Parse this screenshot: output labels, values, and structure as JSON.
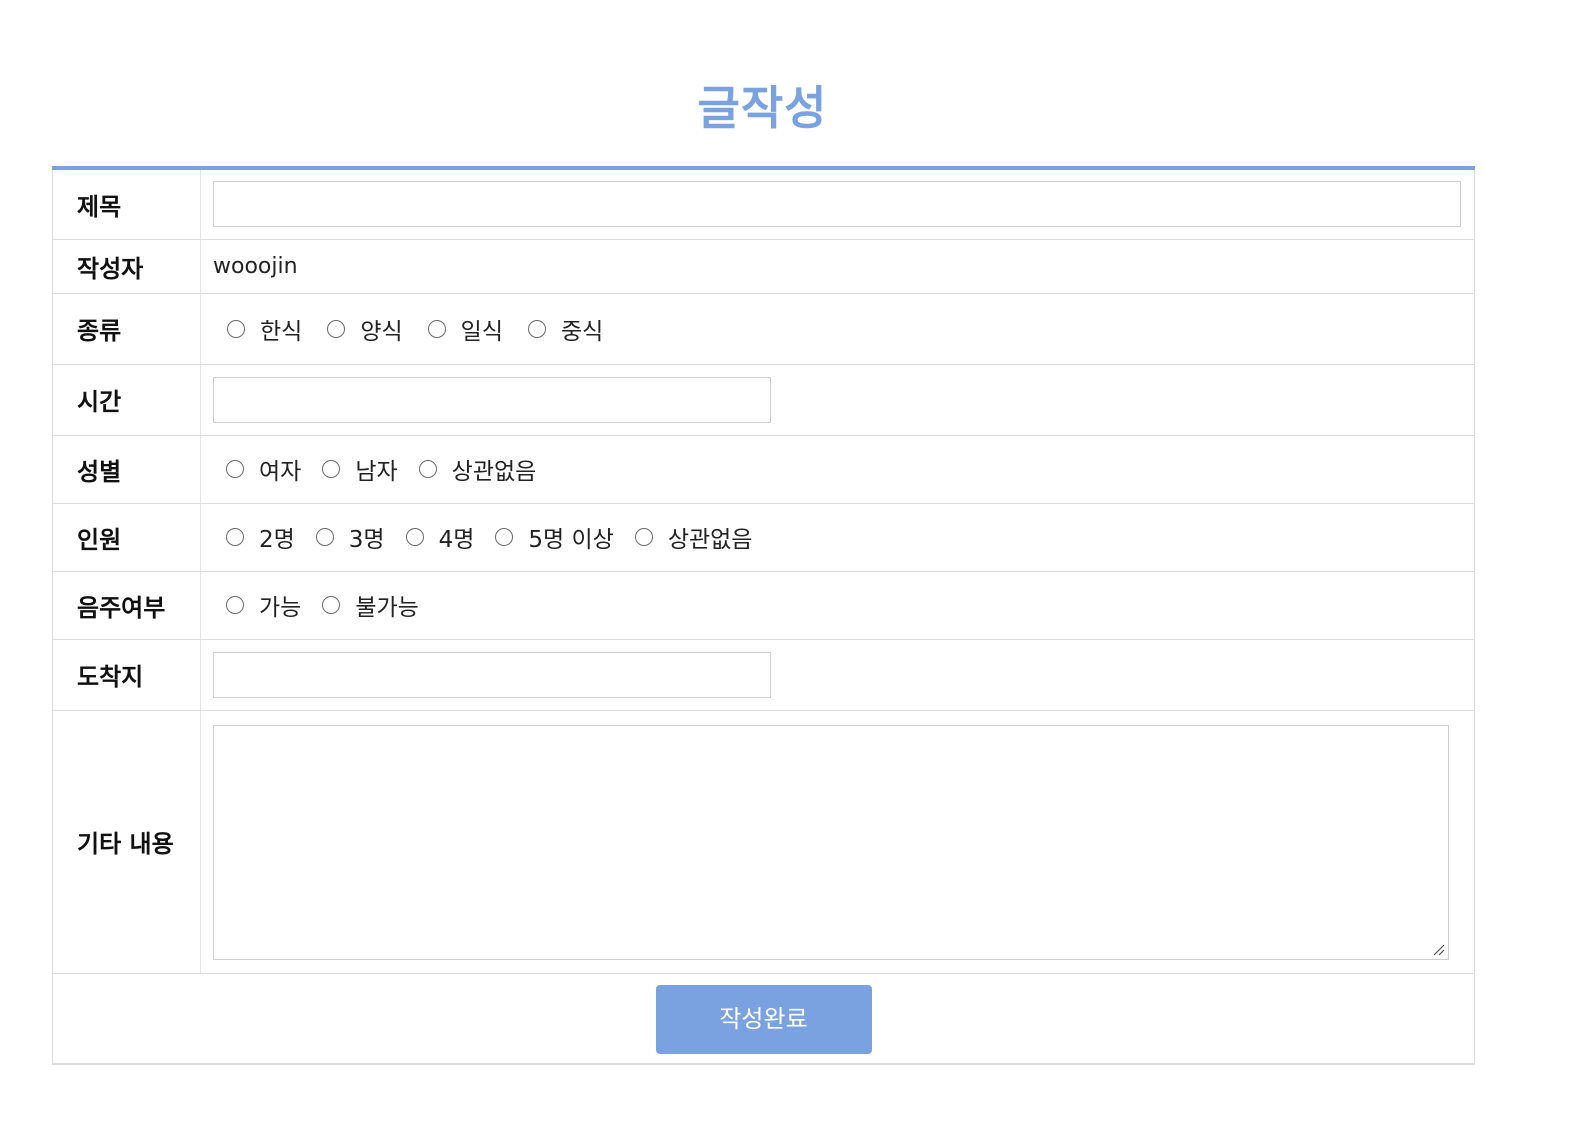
{
  "page": {
    "title": "글작성"
  },
  "form": {
    "title": {
      "label": "제목",
      "value": "",
      "placeholder": ""
    },
    "writer": {
      "label": "작성자",
      "value": "wooojin"
    },
    "type": {
      "label": "종류",
      "options": [
        "한식",
        "양식",
        "일식",
        "중식"
      ],
      "selected": null
    },
    "time": {
      "label": "시간",
      "value": "",
      "placeholder": ""
    },
    "gender": {
      "label": "성별",
      "options": [
        "여자",
        "남자",
        "상관없음"
      ],
      "selected": null
    },
    "people": {
      "label": "인원",
      "options": [
        "2명",
        "3명",
        "4명",
        "5명 이상",
        "상관없음"
      ],
      "selected": null
    },
    "drink": {
      "label": "음주여부",
      "options": [
        "가능",
        "불가능"
      ],
      "selected": null
    },
    "destination": {
      "label": "도착지",
      "value": "",
      "placeholder": ""
    },
    "etc": {
      "label": "기타 내용",
      "value": "",
      "placeholder": ""
    },
    "submit_label": "작성완료"
  },
  "colors": {
    "accent": "#7aa2e0",
    "border": "#dcdcdc",
    "text": "#222222"
  },
  "icons": {
    "radio": "radio-button-unchecked-icon",
    "resize": "textarea-resize-handle-icon"
  }
}
